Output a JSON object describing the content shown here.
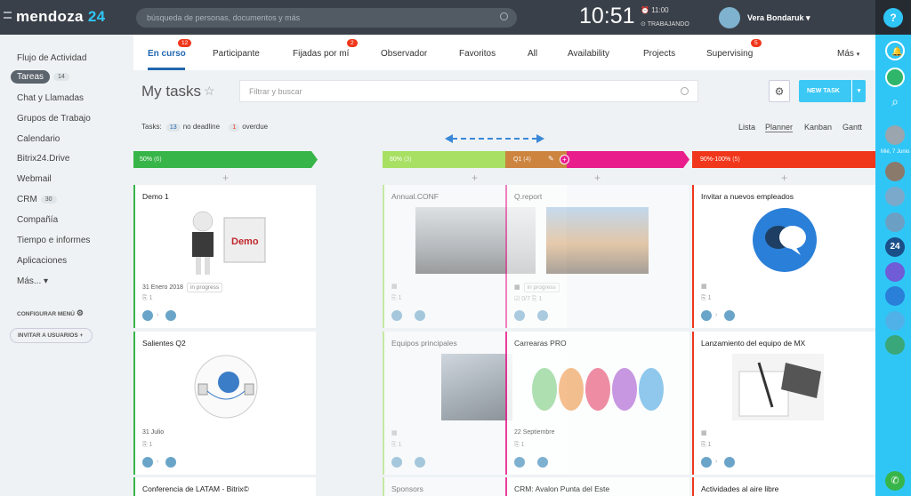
{
  "header": {
    "brand": "mendoza",
    "brand_suffix": "24",
    "search_placeholder": "búsqueda de personas, documentos y más",
    "time": "10:51",
    "alarm": "11:00",
    "status": "TRABAJANDO",
    "user_name": "Vera Bondaruk",
    "help": "?"
  },
  "sidebar": {
    "items": [
      {
        "label": "Flujo de Actividad"
      },
      {
        "label": "Tareas",
        "badge": "14"
      },
      {
        "label": "Chat y Llamadas"
      },
      {
        "label": "Grupos de Trabajo"
      },
      {
        "label": "Calendario"
      },
      {
        "label": "Bitrix24.Drive"
      },
      {
        "label": "Webmail"
      },
      {
        "label": "CRM",
        "badge": "30"
      },
      {
        "label": "Compañía"
      },
      {
        "label": "Tiempo e informes"
      },
      {
        "label": "Aplicaciones"
      },
      {
        "label": "Más..."
      }
    ],
    "config": "CONFIGURAR MENÚ",
    "invite": "INVITAR A USUARIOS"
  },
  "tabs": [
    {
      "label": "En curso",
      "badge": "12"
    },
    {
      "label": "Participante"
    },
    {
      "label": "Fijadas por mí",
      "badge": "2"
    },
    {
      "label": "Observador"
    },
    {
      "label": "Favoritos"
    },
    {
      "label": "All"
    },
    {
      "label": "Availability"
    },
    {
      "label": "Projects"
    },
    {
      "label": "Supervising",
      "badge": "5"
    },
    {
      "label": "Más"
    }
  ],
  "page": {
    "title": "My tasks",
    "filter_placeholder": "Filtrar y buscar",
    "new_task": "NEW TASK",
    "tasks_label": "Tasks:",
    "no_deadline_count": "13",
    "no_deadline_label": "no deadline",
    "overdue_count": "1",
    "overdue_label": "overdue",
    "views": [
      "Lista",
      "Planner",
      "Kanban",
      "Gantt"
    ],
    "date_label": "Mié, 7 Junio"
  },
  "columns": [
    {
      "label": "50%",
      "count": "(6)",
      "color": "#38b549"
    },
    {
      "label": "80%",
      "count": "(3)",
      "color": "#a7e062"
    },
    {
      "label": "Q1",
      "count": "(4)",
      "color": "#c98f36"
    },
    {
      "label": "90%-100%",
      "count": "(5)",
      "color": "#f0371b"
    }
  ],
  "cards": {
    "c1": {
      "title": "Demo 1",
      "date": "31 Enero 2018",
      "status": "in progress",
      "files": "1",
      "img": "Demo"
    },
    "c2": {
      "title": "Salientes Q2",
      "date": "31 Julio",
      "files": "1"
    },
    "c3": {
      "title": "Conferencia de LATAM - Bitrix©"
    },
    "c4": {
      "title": "Annual.CONF",
      "files": "1"
    },
    "c5": {
      "title": "Equipos principales",
      "files": "1"
    },
    "c6": {
      "title": "Sponsors"
    },
    "c7": {
      "title": "Q.report",
      "status": "in progress",
      "files": "0/7",
      "files2": "1"
    },
    "c8": {
      "title": "Carrearas PRO",
      "date": "22 Septiembre",
      "files": "1"
    },
    "c9": {
      "title": "CRM: Avalon Punta del Este"
    },
    "c10": {
      "title": "Invitar a nuevos empleados",
      "files": "1"
    },
    "c11": {
      "title": "Lanzamiento del equipo de MX",
      "files": "1"
    },
    "c12": {
      "title": "Actividades al aire libre"
    }
  }
}
